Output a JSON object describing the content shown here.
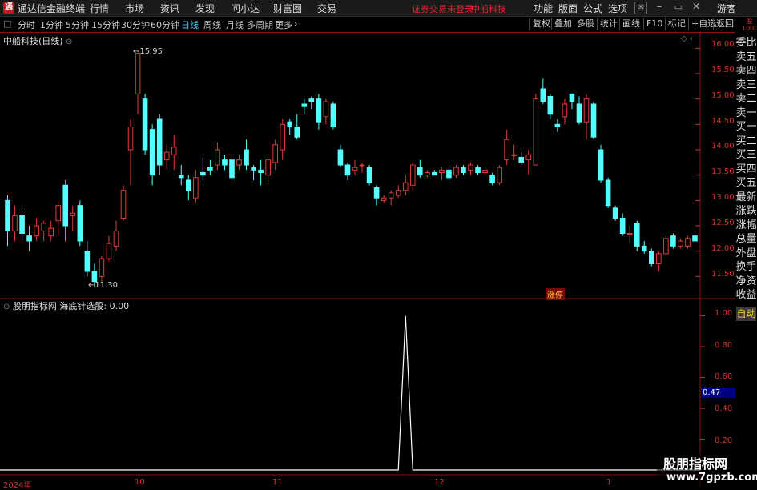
{
  "titlebar": {
    "logo_text": "通",
    "app_title": "通达信金融终端",
    "menus": [
      "行情",
      "市场",
      "资讯",
      "发现",
      "问小达",
      "财富圈",
      "交易"
    ],
    "status": "证券交易未登录",
    "stock_short": "中船科技",
    "right_menus": [
      "功能",
      "版面",
      "公式",
      "选项"
    ],
    "guest": "游客"
  },
  "toolbar": {
    "periods": [
      "分时",
      "1分钟",
      "5分钟",
      "15分钟",
      "30分钟",
      "60分钟",
      "日线",
      "周线",
      "月线",
      "多周期",
      "更多"
    ],
    "active": "日线",
    "right_buttons": [
      "复权",
      "叠加",
      "多股",
      "统计",
      "画线",
      "F10",
      "标记",
      "+自选",
      "返回"
    ]
  },
  "sidebar": {
    "top_label": "股\n1000",
    "items": [
      "委比",
      "卖五",
      "卖四",
      "卖三",
      "卖二",
      "卖一",
      "买一",
      "买二",
      "买三",
      "买四",
      "买五",
      "最新",
      "涨跌",
      "涨幅",
      "总量",
      "外盘",
      "换手",
      "净资",
      "收益"
    ],
    "auto": "自动"
  },
  "main_chart": {
    "title": "中船科技(日线)",
    "high_label": "15.95",
    "low_label": "11.30",
    "zhangting_label": "涨停",
    "price_ticks": [
      "16.00",
      "15.50",
      "15.00",
      "14.50",
      "14.00",
      "13.50",
      "13.00",
      "12.50",
      "12.00",
      "11.50"
    ]
  },
  "indicator": {
    "title_source": "股朋指标网",
    "title_name": "海底针选股",
    "title_value": "0.00",
    "ticks": [
      "1.00",
      "0.80",
      "0.60",
      "0.40",
      "0.20"
    ],
    "current_value": "0.47"
  },
  "dates": [
    "2024年",
    "10",
    "11",
    "12",
    "1"
  ],
  "watermark": {
    "line1": "股朋指标网",
    "line2": "www.7gpzb.com"
  },
  "colors": {
    "up": "#e03c3c",
    "down": "#54ffff",
    "grid": "#7a0e0e",
    "axis": "#c33"
  },
  "chart_data": {
    "type": "candlestick",
    "ylim": [
      11.3,
      16.1
    ],
    "candles": [
      {
        "o": 13.0,
        "h": 13.1,
        "l": 12.1,
        "c": 12.4
      },
      {
        "o": 12.4,
        "h": 12.9,
        "l": 12.2,
        "c": 12.7
      },
      {
        "o": 12.7,
        "h": 12.8,
        "l": 12.2,
        "c": 12.35
      },
      {
        "o": 12.3,
        "h": 12.5,
        "l": 12.0,
        "c": 12.2
      },
      {
        "o": 12.3,
        "h": 12.65,
        "l": 12.2,
        "c": 12.5
      },
      {
        "o": 12.4,
        "h": 12.6,
        "l": 12.2,
        "c": 12.55
      },
      {
        "o": 12.3,
        "h": 12.6,
        "l": 12.2,
        "c": 12.45
      },
      {
        "o": 12.6,
        "h": 13.0,
        "l": 12.3,
        "c": 12.9
      },
      {
        "o": 13.3,
        "h": 13.4,
        "l": 12.2,
        "c": 12.5
      },
      {
        "o": 12.7,
        "h": 12.9,
        "l": 12.4,
        "c": 12.75
      },
      {
        "o": 12.9,
        "h": 13.0,
        "l": 12.1,
        "c": 12.2
      },
      {
        "o": 12.0,
        "h": 12.2,
        "l": 11.5,
        "c": 11.6
      },
      {
        "o": 11.6,
        "h": 11.75,
        "l": 11.3,
        "c": 11.4
      },
      {
        "o": 11.5,
        "h": 11.9,
        "l": 11.4,
        "c": 11.85
      },
      {
        "o": 11.85,
        "h": 12.3,
        "l": 11.8,
        "c": 12.15
      },
      {
        "o": 12.1,
        "h": 12.6,
        "l": 12.0,
        "c": 12.4
      },
      {
        "o": 12.65,
        "h": 13.3,
        "l": 12.6,
        "c": 13.2
      },
      {
        "o": 14.0,
        "h": 14.6,
        "l": 13.3,
        "c": 14.45
      },
      {
        "o": 15.1,
        "h": 15.95,
        "l": 14.7,
        "c": 15.9
      },
      {
        "o": 15.0,
        "h": 15.1,
        "l": 13.9,
        "c": 14.0
      },
      {
        "o": 14.4,
        "h": 14.5,
        "l": 13.3,
        "c": 13.5
      },
      {
        "o": 14.6,
        "h": 14.7,
        "l": 13.5,
        "c": 13.7
      },
      {
        "o": 13.8,
        "h": 14.1,
        "l": 13.6,
        "c": 13.95
      },
      {
        "o": 13.9,
        "h": 14.3,
        "l": 13.6,
        "c": 14.05
      },
      {
        "o": 13.5,
        "h": 13.7,
        "l": 13.3,
        "c": 13.45
      },
      {
        "o": 13.4,
        "h": 13.5,
        "l": 13.0,
        "c": 13.2
      },
      {
        "o": 13.05,
        "h": 13.6,
        "l": 12.95,
        "c": 13.45
      },
      {
        "o": 13.55,
        "h": 13.85,
        "l": 13.4,
        "c": 13.5
      },
      {
        "o": 13.65,
        "h": 13.8,
        "l": 13.5,
        "c": 13.6
      },
      {
        "o": 13.7,
        "h": 14.15,
        "l": 13.6,
        "c": 14.0
      },
      {
        "o": 13.8,
        "h": 13.9,
        "l": 13.6,
        "c": 13.7
      },
      {
        "o": 13.8,
        "h": 13.9,
        "l": 13.4,
        "c": 13.45
      },
      {
        "o": 13.7,
        "h": 13.9,
        "l": 13.6,
        "c": 13.8
      },
      {
        "o": 14.0,
        "h": 14.2,
        "l": 13.6,
        "c": 13.7
      },
      {
        "o": 13.65,
        "h": 13.7,
        "l": 13.4,
        "c": 13.6
      },
      {
        "o": 13.6,
        "h": 13.8,
        "l": 13.3,
        "c": 13.55
      },
      {
        "o": 13.5,
        "h": 13.9,
        "l": 13.3,
        "c": 13.8
      },
      {
        "o": 13.75,
        "h": 14.2,
        "l": 13.6,
        "c": 14.1
      },
      {
        "o": 14.0,
        "h": 14.6,
        "l": 13.8,
        "c": 14.5
      },
      {
        "o": 14.55,
        "h": 14.6,
        "l": 14.3,
        "c": 14.45
      },
      {
        "o": 14.45,
        "h": 14.7,
        "l": 14.2,
        "c": 14.25
      },
      {
        "o": 14.9,
        "h": 15.0,
        "l": 14.7,
        "c": 14.85
      },
      {
        "o": 15.0,
        "h": 15.05,
        "l": 14.8,
        "c": 14.95
      },
      {
        "o": 15.0,
        "h": 15.1,
        "l": 14.4,
        "c": 14.55
      },
      {
        "o": 14.65,
        "h": 15.0,
        "l": 14.5,
        "c": 14.95
      },
      {
        "o": 14.9,
        "h": 14.95,
        "l": 14.4,
        "c": 14.45
      },
      {
        "o": 14.0,
        "h": 14.1,
        "l": 13.65,
        "c": 13.7
      },
      {
        "o": 13.7,
        "h": 13.75,
        "l": 13.4,
        "c": 13.5
      },
      {
        "o": 13.6,
        "h": 13.8,
        "l": 13.5,
        "c": 13.65
      },
      {
        "o": 13.7,
        "h": 13.75,
        "l": 13.55,
        "c": 13.7
      },
      {
        "o": 13.65,
        "h": 13.7,
        "l": 13.3,
        "c": 13.35
      },
      {
        "o": 13.25,
        "h": 13.3,
        "l": 12.9,
        "c": 13.05
      },
      {
        "o": 13.0,
        "h": 13.1,
        "l": 12.95,
        "c": 13.05
      },
      {
        "o": 13.05,
        "h": 13.2,
        "l": 12.9,
        "c": 13.15
      },
      {
        "o": 13.1,
        "h": 13.3,
        "l": 13.05,
        "c": 13.2
      },
      {
        "o": 13.2,
        "h": 13.5,
        "l": 13.1,
        "c": 13.35
      },
      {
        "o": 13.3,
        "h": 13.75,
        "l": 13.2,
        "c": 13.7
      },
      {
        "o": 13.65,
        "h": 13.8,
        "l": 13.45,
        "c": 13.5
      },
      {
        "o": 13.5,
        "h": 13.6,
        "l": 13.45,
        "c": 13.55
      },
      {
        "o": 13.55,
        "h": 13.6,
        "l": 13.5,
        "c": 13.5
      },
      {
        "o": 13.55,
        "h": 13.65,
        "l": 13.4,
        "c": 13.6
      },
      {
        "o": 13.6,
        "h": 13.7,
        "l": 13.4,
        "c": 13.45
      },
      {
        "o": 13.5,
        "h": 13.7,
        "l": 13.45,
        "c": 13.65
      },
      {
        "o": 13.65,
        "h": 13.7,
        "l": 13.5,
        "c": 13.55
      },
      {
        "o": 13.6,
        "h": 13.75,
        "l": 13.5,
        "c": 13.7
      },
      {
        "o": 13.65,
        "h": 13.7,
        "l": 13.5,
        "c": 13.55
      },
      {
        "o": 13.55,
        "h": 13.6,
        "l": 13.5,
        "c": 13.6
      },
      {
        "o": 13.5,
        "h": 13.55,
        "l": 13.3,
        "c": 13.35
      },
      {
        "o": 13.35,
        "h": 13.7,
        "l": 13.3,
        "c": 13.65
      },
      {
        "o": 13.8,
        "h": 14.4,
        "l": 13.7,
        "c": 14.2
      },
      {
        "o": 13.9,
        "h": 14.1,
        "l": 13.8,
        "c": 13.9
      },
      {
        "o": 13.85,
        "h": 13.95,
        "l": 13.7,
        "c": 13.75
      },
      {
        "o": 13.8,
        "h": 14.0,
        "l": 13.5,
        "c": 13.9
      },
      {
        "o": 13.7,
        "h": 15.1,
        "l": 13.7,
        "c": 15.0
      },
      {
        "o": 15.2,
        "h": 15.4,
        "l": 14.9,
        "c": 14.95
      },
      {
        "o": 15.05,
        "h": 15.1,
        "l": 14.6,
        "c": 14.7
      },
      {
        "o": 14.5,
        "h": 14.6,
        "l": 14.35,
        "c": 14.45
      },
      {
        "o": 14.65,
        "h": 15.0,
        "l": 14.5,
        "c": 14.9
      },
      {
        "o": 15.1,
        "h": 15.1,
        "l": 14.8,
        "c": 14.95
      },
      {
        "o": 14.9,
        "h": 15.05,
        "l": 14.5,
        "c": 14.55
      },
      {
        "o": 14.55,
        "h": 15.1,
        "l": 14.2,
        "c": 15.0
      },
      {
        "o": 14.9,
        "h": 14.95,
        "l": 14.2,
        "c": 14.25
      },
      {
        "o": 14.0,
        "h": 14.1,
        "l": 13.35,
        "c": 13.4
      },
      {
        "o": 13.4,
        "h": 13.45,
        "l": 12.85,
        "c": 12.9
      },
      {
        "o": 12.85,
        "h": 12.9,
        "l": 12.6,
        "c": 12.65
      },
      {
        "o": 12.65,
        "h": 12.75,
        "l": 12.3,
        "c": 12.35
      },
      {
        "o": 12.35,
        "h": 12.5,
        "l": 12.15,
        "c": 12.35
      },
      {
        "o": 12.55,
        "h": 12.6,
        "l": 12.0,
        "c": 12.1
      },
      {
        "o": 12.1,
        "h": 12.2,
        "l": 11.95,
        "c": 12.0
      },
      {
        "o": 12.0,
        "h": 12.05,
        "l": 11.7,
        "c": 11.75
      },
      {
        "o": 11.75,
        "h": 12.0,
        "l": 11.6,
        "c": 11.95
      },
      {
        "o": 11.95,
        "h": 12.3,
        "l": 11.9,
        "c": 12.25
      },
      {
        "o": 12.3,
        "h": 12.35,
        "l": 12.05,
        "c": 12.1
      },
      {
        "o": 12.1,
        "h": 12.25,
        "l": 12.05,
        "c": 12.2
      },
      {
        "o": 12.1,
        "h": 12.3,
        "l": 12.05,
        "c": 12.25
      },
      {
        "o": 12.3,
        "h": 12.35,
        "l": 12.2,
        "c": 12.2
      }
    ],
    "indicator_series": {
      "name": "海底针选股",
      "spike_index": 55,
      "spike_value": 1.0,
      "baseline": 0.0,
      "ylim": [
        0,
        1.05
      ]
    }
  }
}
